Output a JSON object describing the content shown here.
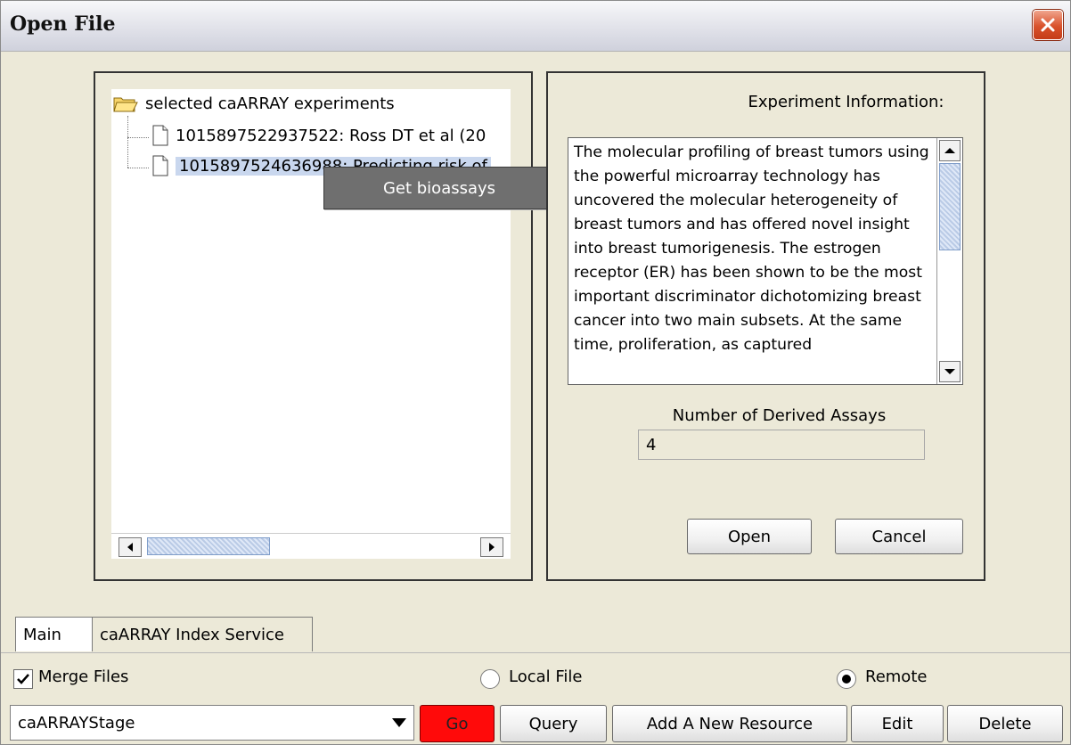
{
  "window": {
    "title": "Open File"
  },
  "tree": {
    "root": {
      "label": "selected caARRAY experiments"
    },
    "items": [
      {
        "label": "1015897522937522: Ross DT et al (20"
      },
      {
        "label": "1015897524636988: Predicting risk of"
      }
    ]
  },
  "context_menu": {
    "item": "Get bioassays"
  },
  "experiment": {
    "label": "Experiment Information:",
    "text": "The molecular profiling of breast tumors using the powerful microarray technology has uncovered the molecular heterogeneity of breast tumors and has offered novel insight into breast tumorigenesis. The estrogen receptor (ER) has been shown to be the most important discriminator dichotomizing breast cancer into two main subsets. At the same time, proliferation, as captured"
  },
  "derived_assays": {
    "label": "Number of Derived Assays",
    "value": "4"
  },
  "buttons": {
    "open": "Open",
    "cancel": "Cancel",
    "go": "Go",
    "query": "Query",
    "add": "Add A New Resource",
    "edit": "Edit",
    "delete": "Delete"
  },
  "tabs": {
    "main": "Main",
    "caarray": "caARRAY Index Service"
  },
  "options": {
    "merge": "Merge Files",
    "local": "Local File",
    "remote": "Remote"
  },
  "resource": {
    "selected": "caARRAYStage"
  },
  "colors": {
    "go_button": "#ff0a0a",
    "selection": "#c9d7ee"
  }
}
